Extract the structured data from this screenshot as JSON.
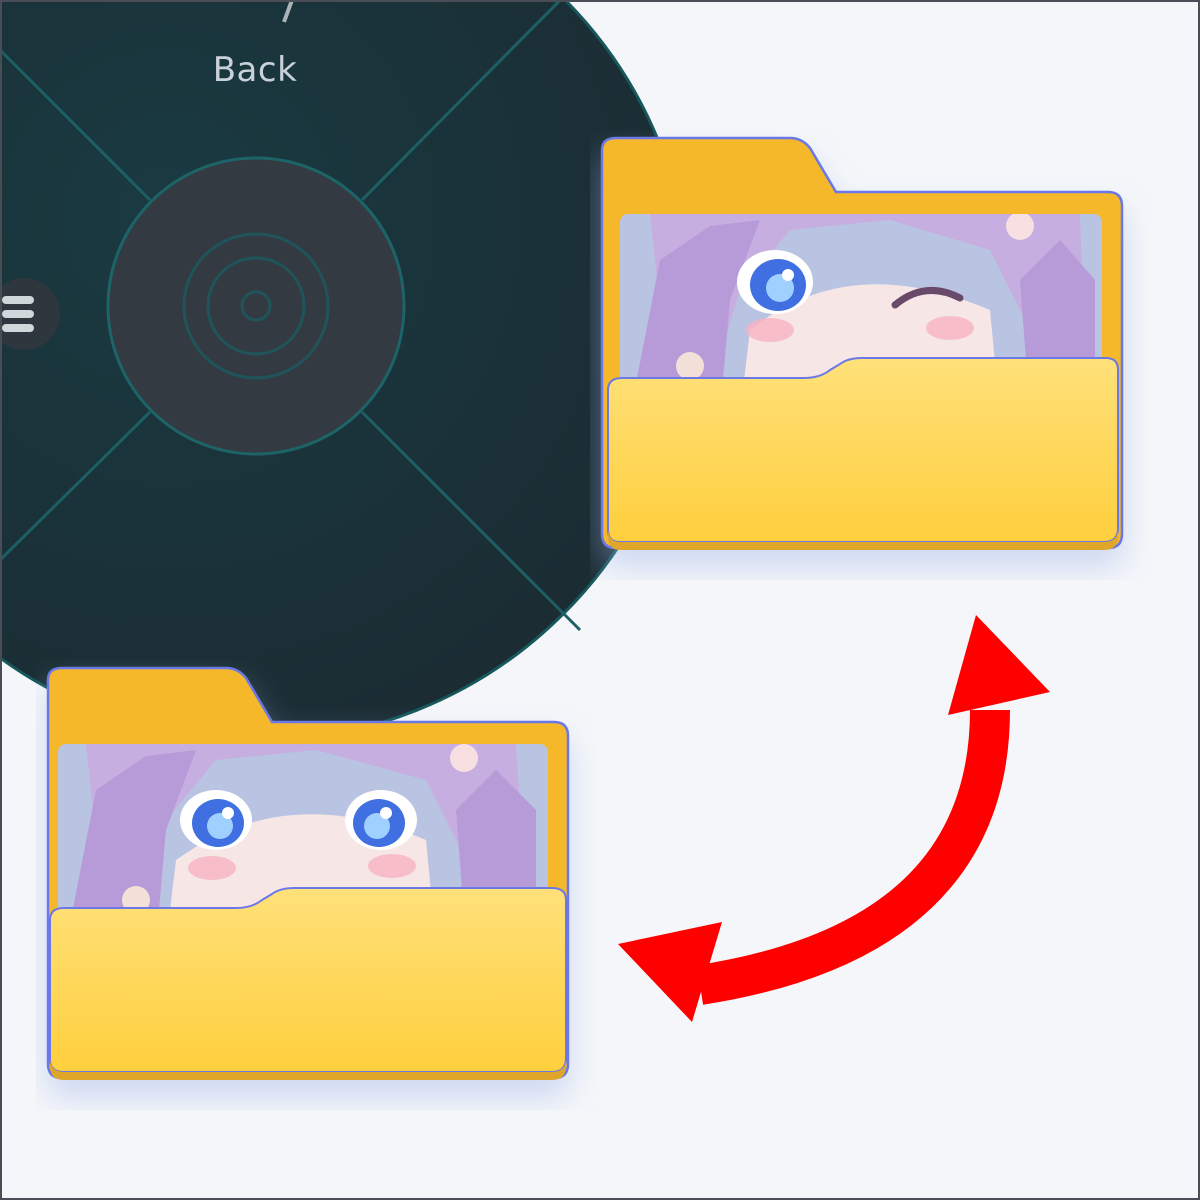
{
  "radial_menu": {
    "back_label": "Back",
    "center_icon": "target-rings-icon",
    "menu_icon": "hamburger-menu-icon"
  },
  "folders": [
    {
      "name": "folder-winking",
      "icon": "folder-icon",
      "content": "anime-character-winking"
    },
    {
      "name": "folder-open-eyes",
      "icon": "folder-icon",
      "content": "anime-character-eyes-open"
    }
  ],
  "swap_arrow": {
    "icon": "double-headed-curved-arrow-icon",
    "color": "#ff0000"
  },
  "colors": {
    "radial_bg": "#1d3138",
    "radial_accent": "#1a6b70",
    "folder_yellow": "#ffc928",
    "folder_outline": "#6b78e8"
  }
}
